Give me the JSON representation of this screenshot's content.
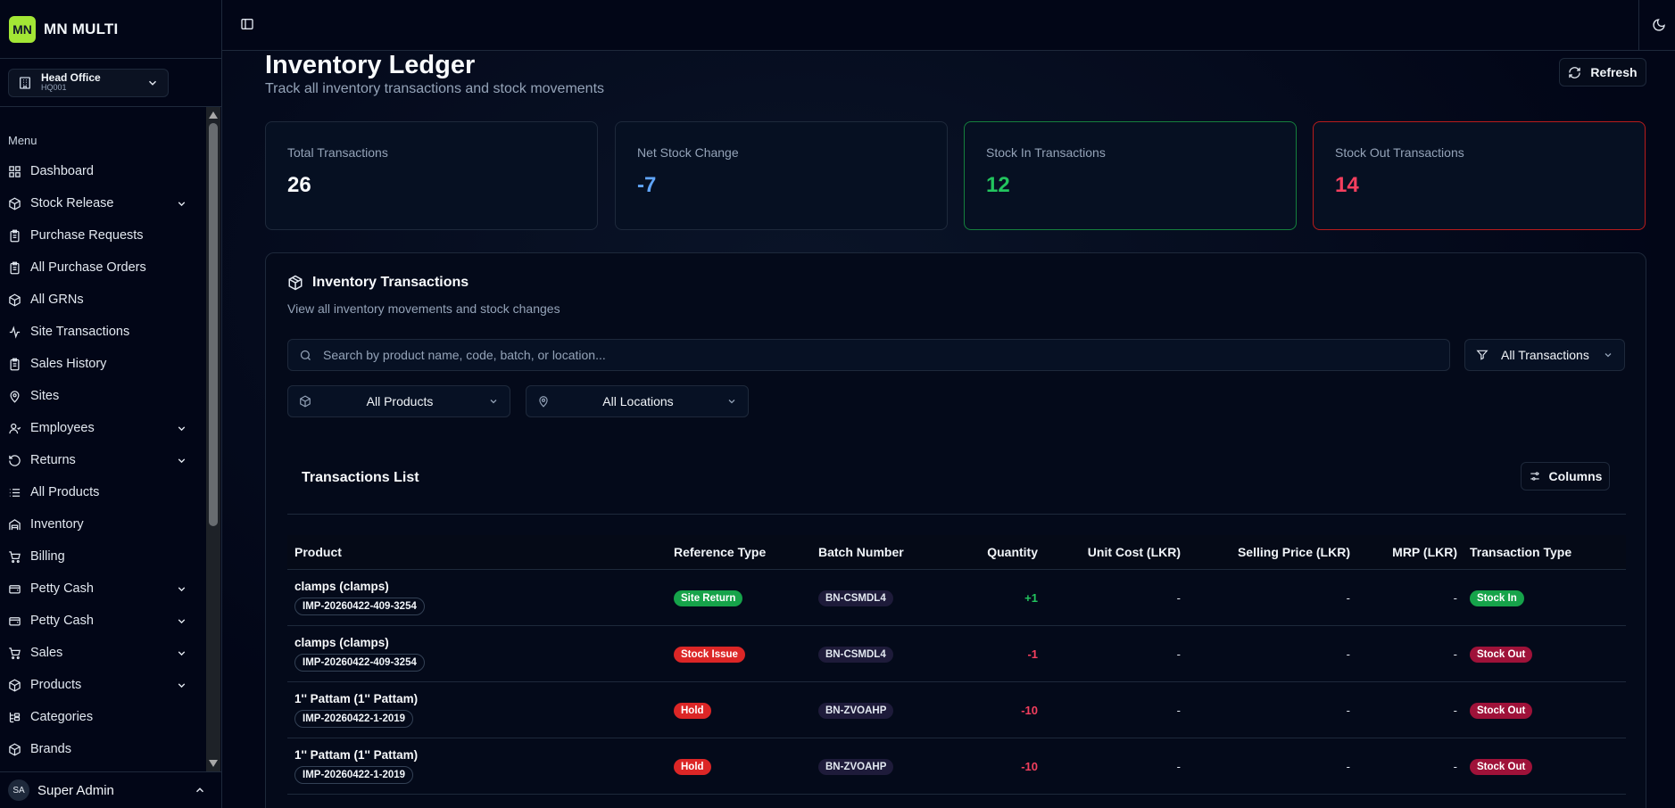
{
  "brand": {
    "logo": "MN",
    "name": "MN MULTI"
  },
  "branch": {
    "name": "Head Office",
    "code": "HQ001",
    "icon": "building-icon"
  },
  "sidebar": {
    "menu_heading": "Menu",
    "items": [
      {
        "label": "Dashboard",
        "icon": "dashboard-icon",
        "has_children": false
      },
      {
        "label": "Stock Release",
        "icon": "package-icon",
        "has_children": true
      },
      {
        "label": "Purchase Requests",
        "icon": "clipboard-icon",
        "has_children": false
      },
      {
        "label": "All Purchase Orders",
        "icon": "clipboard-icon",
        "has_children": false
      },
      {
        "label": "All GRNs",
        "icon": "package-icon",
        "has_children": false
      },
      {
        "label": "Site Transactions",
        "icon": "activity-icon",
        "has_children": false
      },
      {
        "label": "Sales History",
        "icon": "clipboard-icon",
        "has_children": false
      },
      {
        "label": "Sites",
        "icon": "map-pin-icon",
        "has_children": false
      },
      {
        "label": "Employees",
        "icon": "user-icon",
        "has_children": true
      },
      {
        "label": "Returns",
        "icon": "rotate-ccw-icon",
        "has_children": true
      },
      {
        "label": "All Products",
        "icon": "list-icon",
        "has_children": false
      },
      {
        "label": "Inventory",
        "icon": "warehouse-icon",
        "has_children": false
      },
      {
        "label": "Billing",
        "icon": "cart-icon",
        "has_children": false
      },
      {
        "label": "Petty Cash",
        "icon": "wallet-icon",
        "has_children": true
      },
      {
        "label": "Petty Cash",
        "icon": "wallet-icon",
        "has_children": true
      },
      {
        "label": "Sales",
        "icon": "cart-icon",
        "has_children": true
      },
      {
        "label": "Products",
        "icon": "package-icon",
        "has_children": true
      },
      {
        "label": "Categories",
        "icon": "tree-icon",
        "has_children": false
      },
      {
        "label": "Brands",
        "icon": "package-icon",
        "has_children": false
      }
    ]
  },
  "user": {
    "initials": "SA",
    "name": "Super Admin"
  },
  "header": {
    "title": "Inventory Ledger",
    "subtitle": "Track all inventory transactions and stock movements",
    "refresh_label": "Refresh"
  },
  "stats": [
    {
      "label": "Total Transactions",
      "value": "26"
    },
    {
      "label": "Net Stock Change",
      "value": "-7"
    },
    {
      "label": "Stock In Transactions",
      "value": "12"
    },
    {
      "label": "Stock Out Transactions",
      "value": "14"
    }
  ],
  "panel": {
    "title": "Inventory Transactions",
    "subtitle": "View all inventory movements and stock changes",
    "search_placeholder": "Search by product name, code, batch, or location...",
    "filter_transactions": "All Transactions",
    "filter_products": "All Products",
    "filter_locations": "All Locations",
    "list_title": "Transactions List",
    "columns_label": "Columns"
  },
  "table": {
    "headers": [
      "Product",
      "Reference Type",
      "Batch Number",
      "Quantity",
      "Unit Cost (LKR)",
      "Selling Price (LKR)",
      "MRP (LKR)",
      "Transaction Type"
    ],
    "rows": [
      {
        "product": "clamps (clamps)",
        "code": "IMP-20260422-409-3254",
        "ref_type": "Site Return",
        "ref_color": "green",
        "batch": "BN-CSMDL4",
        "quantity": "+1",
        "unit_cost": "-",
        "selling_price": "-",
        "mrp": "-",
        "txn_type": "Stock In",
        "txn_color": "green"
      },
      {
        "product": "clamps (clamps)",
        "code": "IMP-20260422-409-3254",
        "ref_type": "Stock Issue",
        "ref_color": "red",
        "batch": "BN-CSMDL4",
        "quantity": "-1",
        "unit_cost": "-",
        "selling_price": "-",
        "mrp": "-",
        "txn_type": "Stock Out",
        "txn_color": "darkred"
      },
      {
        "product": "1'' Pattam (1'' Pattam)",
        "code": "IMP-20260422-1-2019",
        "ref_type": "Hold",
        "ref_color": "red",
        "batch": "BN-ZVOAHP",
        "quantity": "-10",
        "unit_cost": "-",
        "selling_price": "-",
        "mrp": "-",
        "txn_type": "Stock Out",
        "txn_color": "darkred"
      },
      {
        "product": "1'' Pattam (1'' Pattam)",
        "code": "IMP-20260422-1-2019",
        "ref_type": "Hold",
        "ref_color": "red",
        "batch": "BN-ZVOAHP",
        "quantity": "-10",
        "unit_cost": "-",
        "selling_price": "-",
        "mrp": "-",
        "txn_type": "Stock Out",
        "txn_color": "darkred"
      }
    ]
  },
  "colors": {
    "accent": "#a3e635",
    "stock_in": "#22c55e",
    "stock_out": "#f43f5e",
    "info": "#60a5fa",
    "background": "#020617"
  }
}
